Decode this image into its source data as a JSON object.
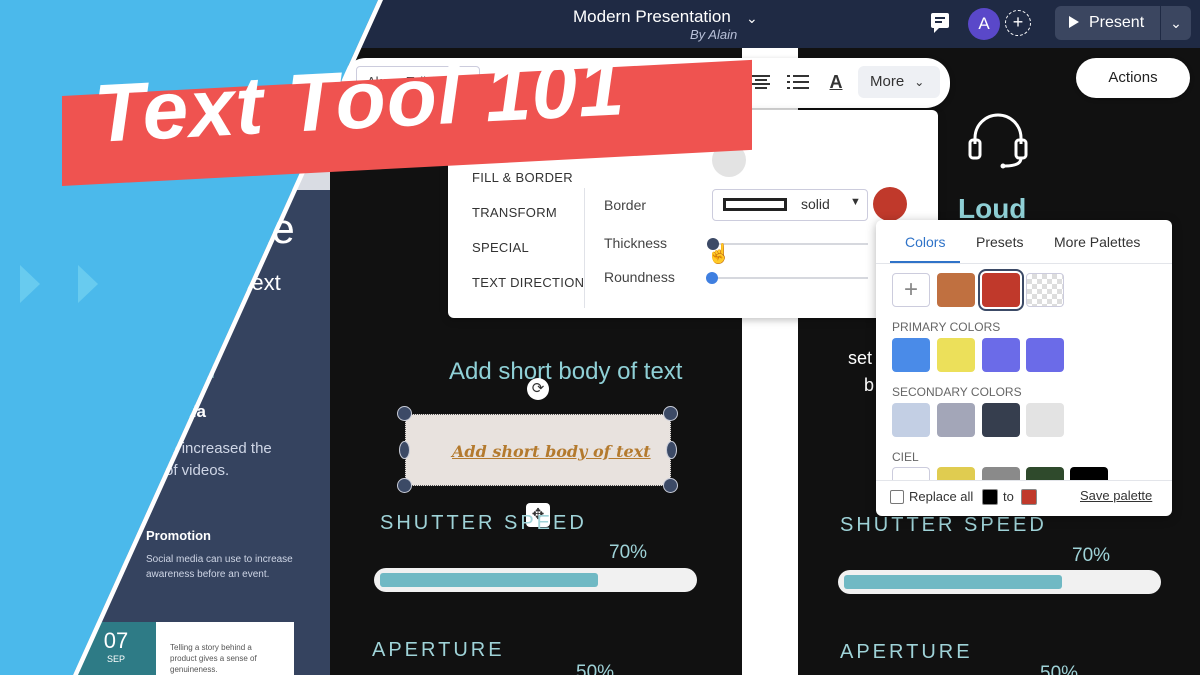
{
  "header": {
    "doc_title": "Modern Presentation",
    "author": "By Alain",
    "avatar_initial": "A",
    "present_label": "Present",
    "actions_label": "Actions"
  },
  "toolbar": {
    "font_name": "Akaya Telivigala",
    "more_label": "More"
  },
  "properties": {
    "nav": [
      "FILL & BORDER",
      "TRANSFORM",
      "SPECIAL",
      "TEXT DIRECTION"
    ],
    "border_label": "Border",
    "border_style": "solid",
    "border_color": "#c0392b",
    "thickness_label": "Thickness",
    "thickness_value": 0.0,
    "roundness_label": "Roundness",
    "roundness_value": 0.0
  },
  "palette": {
    "tabs": [
      "Colors",
      "Presets",
      "More Palettes"
    ],
    "active_tab": "Colors",
    "recent_colors": [
      "#c07040",
      "#c0392b"
    ],
    "primary_label": "PRIMARY COLORS",
    "primary_colors": [
      "#4a8be8",
      "#ece05a",
      "#6b6be8",
      "#6b6be8"
    ],
    "secondary_label": "SECONDARY COLORS",
    "secondary_colors": [
      "#c3cfe4",
      "#a3a6b8",
      "#363e4e",
      "#e3e3e3"
    ],
    "ciel_label": "CIEL",
    "ciel_colors": [
      "#ffffff",
      "#e0cc50",
      "#8a8a8a",
      "#2f4a2c",
      "#000000"
    ],
    "replace_label": "Replace all",
    "replace_from": "#000000",
    "to_label": "to",
    "replace_to": "#c0392b",
    "save_label": "Save palette"
  },
  "slide_left": {
    "title_fragment": "le",
    "subtitle_fragment": "f text",
    "heading_fragment": "edia",
    "body_lines": [
      "have increased the",
      "se of videos."
    ],
    "promo_title": "Promotion",
    "promo_body": "Social media can use to increase awareness before an event.",
    "date_day": "07",
    "date_month": "SEP",
    "card_text": "Telling a story behind a product gives a sense of genuineness."
  },
  "slide_main": {
    "heading": "Add short body of text",
    "selected_text": "Add short body of text",
    "metric1_label": "SHUTTER SPEED",
    "metric1_pct": "70%",
    "metric1_value": 0.7,
    "metric2_label": "APERTURE",
    "metric2_pct": "50%"
  },
  "slide_right": {
    "loud_fragment": "Loud",
    "body_fragment_1": "set",
    "body_fragment_2": "b",
    "metric1_label": "SHUTTER SPEED",
    "metric1_pct": "70%",
    "metric1_value": 0.7,
    "metric2_label": "APERTURE",
    "metric2_pct": "50%"
  },
  "overlay": {
    "title": "Text Tool 101",
    "banner_color": "#ef5350",
    "wedge_color": "#4bb9eb"
  }
}
